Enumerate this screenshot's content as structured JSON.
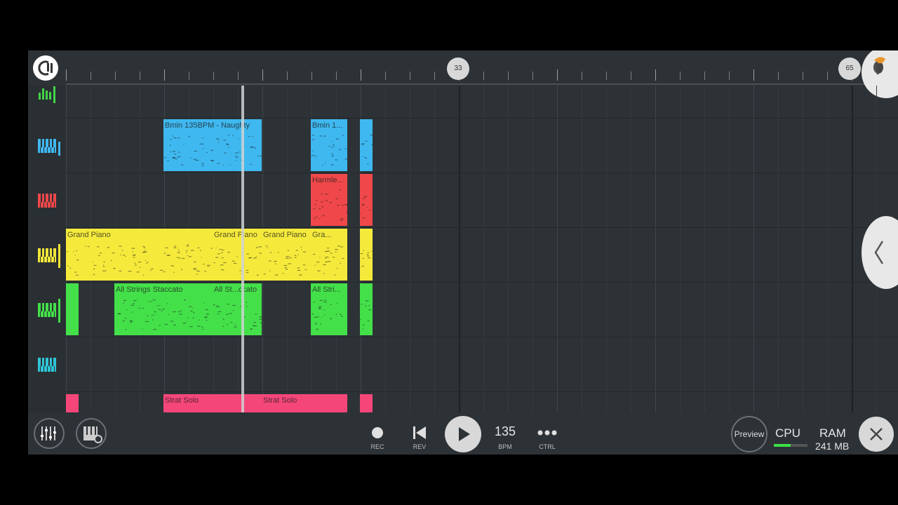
{
  "timeline": {
    "markers": [
      "33",
      "65"
    ]
  },
  "tracks": [
    {
      "icon": "level-meter-icon",
      "color": "#43d34a"
    },
    {
      "icon": "piano-keys-icon",
      "color": "#3fb8f0"
    },
    {
      "icon": "piano-keys-icon",
      "color": "#f0484a"
    },
    {
      "icon": "piano-keys-icon",
      "color": "#f2e63a"
    },
    {
      "icon": "piano-keys-icon",
      "color": "#43e04a"
    },
    {
      "icon": "piano-keys-icon",
      "color": "#2ec6d8"
    }
  ],
  "clips": {
    "bmin_1": "Bmin 135BPM - Naughty",
    "bmin_2": "Bmin 1...",
    "harmle": "Harmle...",
    "grand_piano_1": "Grand Piano",
    "grand_piano_2": "Grand Piano",
    "grand_piano_3": "Grand Piano",
    "grand_piano_4": "Gra...",
    "strings_1": "All Strings Staccato",
    "strings_2": "All St...ccato",
    "strings_3": "All Stri...",
    "strat_1": "Strat Solo",
    "strat_2": "Strat Solo"
  },
  "colors": {
    "blue": "#3fb8f0",
    "red": "#f0484a",
    "yellow": "#f5ea3c",
    "green": "#44e04a",
    "pink": "#f5467a"
  },
  "transport": {
    "rec_label": "REC",
    "rev_label": "REV",
    "tempo_value": "135",
    "tempo_label": "BPM",
    "ctrl_label": "CTRL",
    "preview_label": "Preview",
    "cpu_label": "CPU",
    "cpu_load": 0.5,
    "ram_label": "RAM",
    "ram_value": "241 MB"
  },
  "icons": {
    "mixer": "mixer-icon",
    "plugins": "piano-settings-icon",
    "record": "record-icon",
    "rewind": "skip-back-icon",
    "play": "play-icon",
    "more": "more-dots-icon",
    "close": "close-icon",
    "collapse": "chevron-left-icon",
    "logo": "fl-logo-icon",
    "menu": "fruit-menu-icon"
  }
}
